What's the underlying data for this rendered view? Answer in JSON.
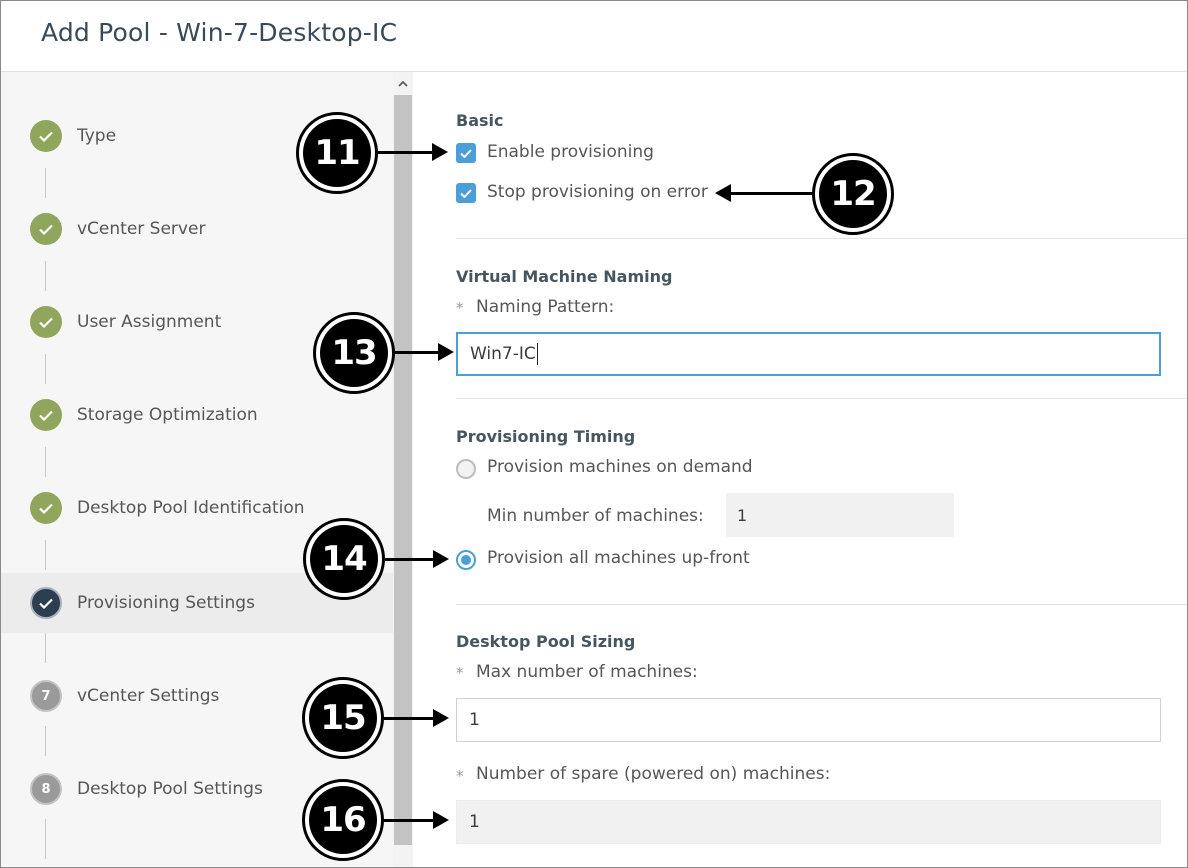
{
  "dialog": {
    "title": "Add Pool - Win-7-Desktop-IC"
  },
  "sidebar": {
    "steps": [
      {
        "label": "Type",
        "status": "done",
        "number": ""
      },
      {
        "label": "vCenter Server",
        "status": "done",
        "number": ""
      },
      {
        "label": "User Assignment",
        "status": "done",
        "number": ""
      },
      {
        "label": "Storage Optimization",
        "status": "done",
        "number": ""
      },
      {
        "label": "Desktop Pool Identification",
        "status": "done",
        "number": ""
      },
      {
        "label": "Provisioning Settings",
        "status": "current",
        "number": ""
      },
      {
        "label": "vCenter Settings",
        "status": "pending",
        "number": "7"
      },
      {
        "label": "Desktop Pool Settings",
        "status": "pending",
        "number": "8"
      }
    ]
  },
  "basic": {
    "title": "Basic",
    "enable_provisioning": {
      "label": "Enable provisioning",
      "checked": true
    },
    "stop_on_error": {
      "label": "Stop provisioning on error",
      "checked": true
    }
  },
  "naming": {
    "title": "Virtual Machine Naming",
    "required_mark": "*",
    "pattern_label": "Naming Pattern:",
    "pattern_value": "Win7-IC"
  },
  "timing": {
    "title": "Provisioning Timing",
    "on_demand_label": "Provision machines on demand",
    "on_demand_selected": false,
    "min_label": "Min number of machines:",
    "min_value": "1",
    "upfront_label": "Provision all machines up-front",
    "upfront_selected": true
  },
  "sizing": {
    "title": "Desktop Pool Sizing",
    "required_mark": "*",
    "max_label": "Max number of machines:",
    "max_value": "1",
    "spare_label": "Number of spare (powered on) machines:",
    "spare_value": "1"
  },
  "callouts": [
    "11",
    "12",
    "13",
    "14",
    "15",
    "16"
  ],
  "colors": {
    "accent": "#4a9fd8",
    "done_step": "#8fa65c",
    "current_step": "#2d3e50",
    "pending_step": "#9a9a9a"
  },
  "icons": {
    "check": "check-icon",
    "scroll_up": "chevron-up-icon"
  }
}
